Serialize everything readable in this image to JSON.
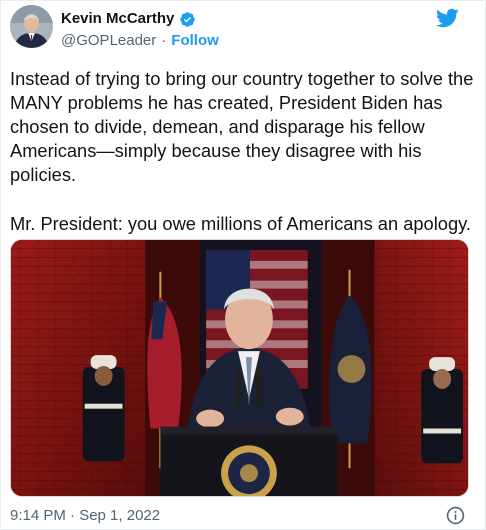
{
  "author": {
    "name": "Kevin McCarthy",
    "handle": "@GOPLeader",
    "separator": "·",
    "follow_label": "Follow",
    "verified": true
  },
  "icons": {
    "avatar": "profile-photo",
    "verified": "verified-badge-icon",
    "brand": "twitter-bird-icon",
    "info": "info-icon"
  },
  "tweet": {
    "paragraph_1": "Instead of trying to bring our country together to solve the MANY problems he has created, President Biden has chosen to divide, demean, and disparage his fellow Americans—simply because they disagree with his policies.",
    "paragraph_2": "Mr. President: you owe millions of Americans an apology.",
    "timestamp": "9:14 PM · Sep 1, 2022"
  },
  "colors": {
    "brand_blue": "#1d9bf0",
    "text_primary": "#0f1419",
    "text_secondary": "#536471"
  }
}
